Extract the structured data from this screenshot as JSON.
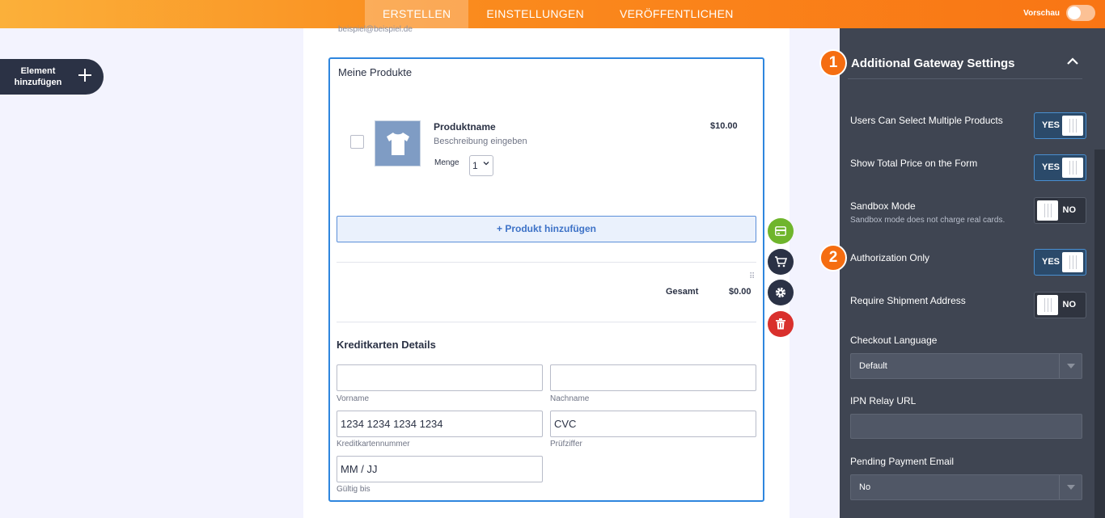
{
  "topbar": {
    "tabs": [
      {
        "label": "ERSTELLEN",
        "active": true
      },
      {
        "label": "EINSTELLUNGEN",
        "active": false
      },
      {
        "label": "VERÖFFENTLICHEN",
        "active": false
      }
    ],
    "preview_label": "Vorschau",
    "gradient": [
      "#fbb03a",
      "#f97514"
    ]
  },
  "sidebar": {
    "add_element_line1": "Element",
    "add_element_line2": "hinzufügen",
    "add_icon": "plus-icon"
  },
  "form": {
    "email_hint": "beispiel@beispiel.de",
    "widget_title": "Meine Produkte",
    "product": {
      "name": "Produktname",
      "description": "Beschreibung eingeben",
      "price": "$10.00",
      "quantity_label": "Menge",
      "quantity_value": "1",
      "image_icon": "tshirt-icon"
    },
    "add_product_label": "+ Produkt hinzufügen",
    "total_label": "Gesamt",
    "total_value": "$0.00",
    "cc_title": "Kreditkarten Details",
    "fields": {
      "first_name_label": "Vorname",
      "last_name_label": "Nachname",
      "card_number_placeholder": "1234 1234 1234 1234",
      "card_number_label": "Kreditkartennummer",
      "cvc_placeholder": "CVC",
      "cvc_label": "Prüfziffer",
      "expiry_placeholder": "MM / JJ",
      "expiry_label": "Gültig bis"
    },
    "accent": "#2e86de"
  },
  "side_actions": [
    {
      "icon": "credit-card-icon",
      "color": "#6fb52c"
    },
    {
      "icon": "cart-icon",
      "color": "#2b3245"
    },
    {
      "icon": "gear-icon",
      "color": "#2b3245"
    },
    {
      "icon": "trash-icon",
      "color": "#d9302c"
    }
  ],
  "panel": {
    "step1": "1",
    "step2": "2",
    "title": "Additional Gateway Settings",
    "settings": {
      "multiple_products": {
        "label": "Users Can Select Multiple Products",
        "value": "YES"
      },
      "total_price": {
        "label": "Show Total Price on the Form",
        "value": "YES"
      },
      "sandbox": {
        "label": "Sandbox Mode",
        "desc": "Sandbox mode does not charge real cards.",
        "value": "NO"
      },
      "auth_only": {
        "label": "Authorization Only",
        "value": "YES"
      },
      "shipment": {
        "label": "Require Shipment Address",
        "value": "NO"
      }
    },
    "checkout_language": {
      "label": "Checkout Language",
      "value": "Default"
    },
    "ipn_relay": {
      "label": "IPN Relay URL",
      "value": ""
    },
    "pending_email": {
      "label": "Pending Payment Email",
      "value": "No"
    },
    "badge_color": "#f56d11"
  }
}
